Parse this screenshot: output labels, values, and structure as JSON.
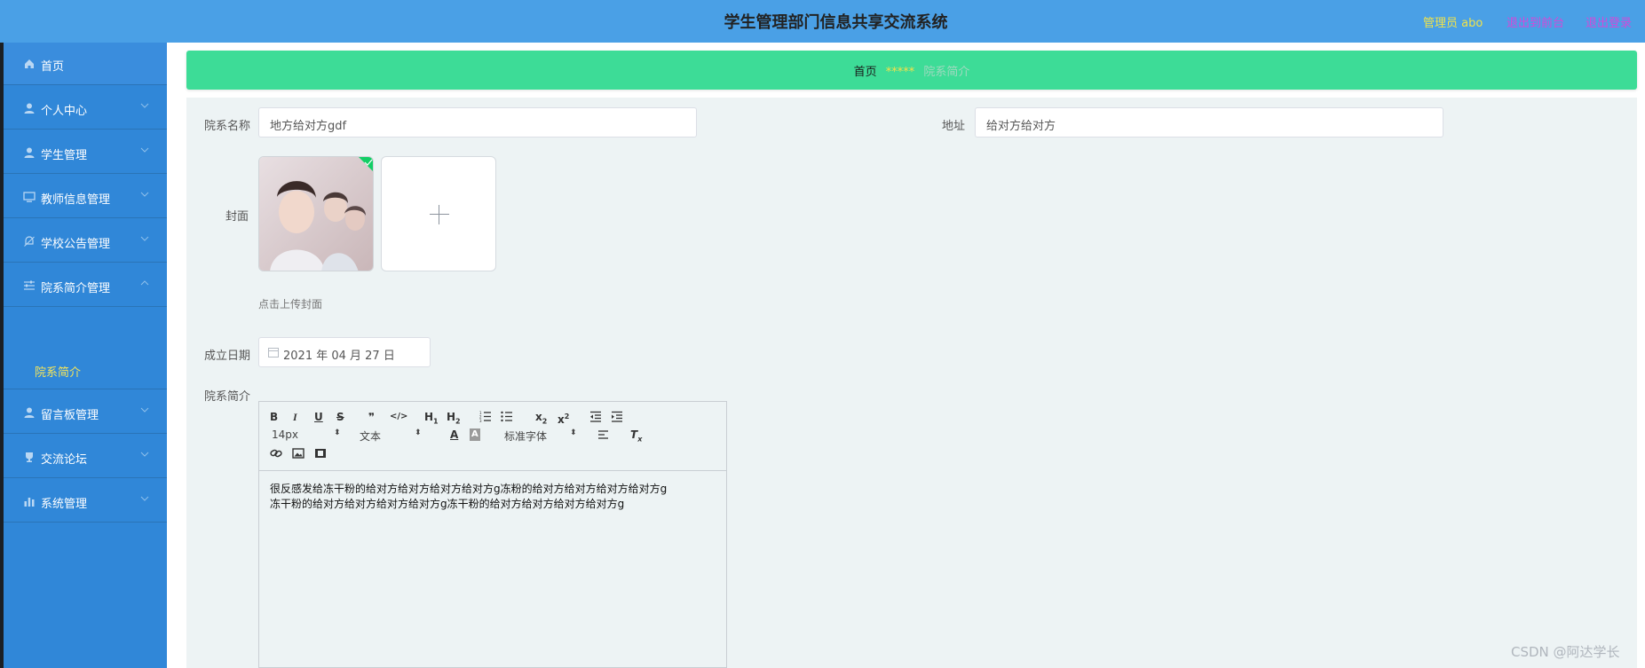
{
  "header": {
    "title": "学生管理部门信息共享交流系统",
    "user_label": "管理员 abo",
    "front_label": "退出到前台",
    "logout_label": "退出登录"
  },
  "sidebar": {
    "items": [
      {
        "label": "首页",
        "icon": "home-icon"
      },
      {
        "label": "个人中心",
        "icon": "user-icon"
      },
      {
        "label": "学生管理",
        "icon": "user-icon"
      },
      {
        "label": "教师信息管理",
        "icon": "monitor-icon"
      },
      {
        "label": "学校公告管理",
        "icon": "bell-icon"
      },
      {
        "label": "院系简介管理",
        "icon": "sliders-icon"
      },
      {
        "label": "留言板管理",
        "icon": "user-icon"
      },
      {
        "label": "交流论坛",
        "icon": "trophy-icon"
      },
      {
        "label": "系统管理",
        "icon": "bar-chart-icon"
      }
    ],
    "submenu": {
      "label": "院系简介"
    }
  },
  "breadcrumb": {
    "home": "首页",
    "separator": "*****",
    "current": "院系简介"
  },
  "form": {
    "name_label": "院系名称",
    "name_value": "地方给对方gdf",
    "address_label": "地址",
    "address_value": "给对方给对方",
    "cover_label": "封面",
    "cover_tip": "点击上传封面",
    "date_label": "成立日期",
    "date_value": "2021 年 04 月 27 日",
    "intro_label": "院系简介"
  },
  "editor": {
    "font_size": "14px",
    "block_format": "文本",
    "font_family": "标准字体",
    "content_line1": " 很反感发给冻干粉的给对方给对方给对方给对方g冻粉的给对方给对方给对方给对方g",
    "content_line2": "冻干粉的给对方给对方给对方给对方g冻干粉的给对方给对方给对方给对方g"
  },
  "watermark": "CSDN @阿达学长",
  "colors": {
    "topbar": "#4aa0e6",
    "sidebar": "#3087d8",
    "breadcrumb": "#3ddc97",
    "form_bg": "#edf3f4",
    "active_text": "#f3e45b",
    "link_purple": "#d24ad9"
  }
}
